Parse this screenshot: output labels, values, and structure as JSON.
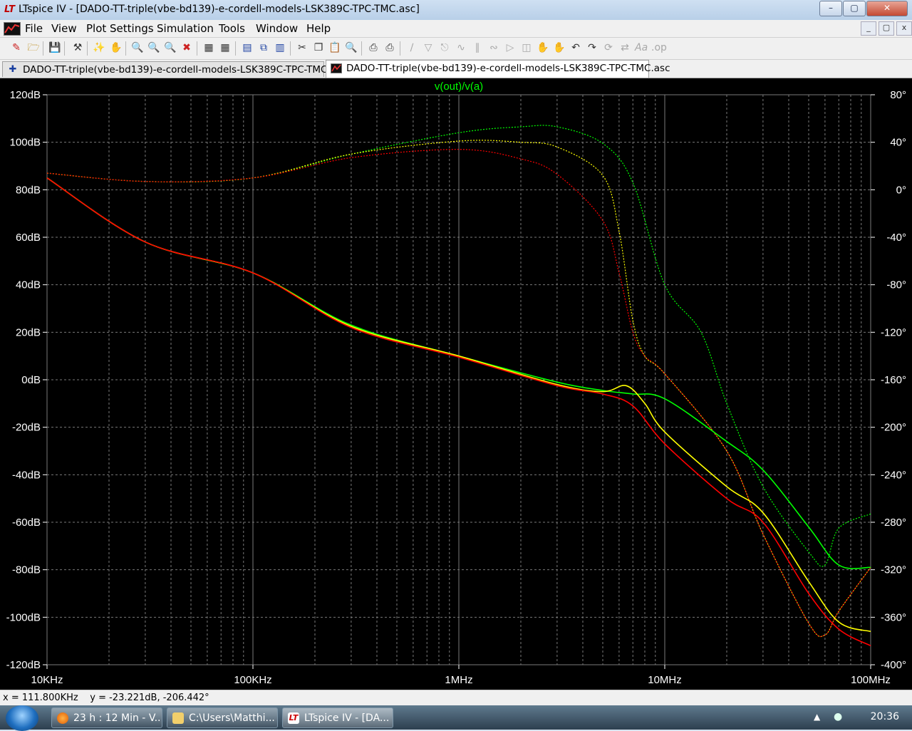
{
  "window": {
    "title": "LTspice IV - [DADO-TT-triple(vbe-bd139)-e-cordell-models-LSK389C-TPC-TMC.asc]",
    "app_icon": "ltspice-logo-icon",
    "controls": {
      "minimize": "–",
      "maximize": "▢",
      "close": "✕"
    }
  },
  "menu": {
    "items": [
      "File",
      "View",
      "Plot Settings",
      "Simulation",
      "Tools",
      "Window",
      "Help"
    ],
    "mdi_controls": [
      "_",
      "▢",
      "x"
    ]
  },
  "toolbar": {
    "icons": [
      "new-schematic-icon",
      "open-icon",
      "save-icon",
      "control-panel-icon",
      "run-icon",
      "pan-hand-icon",
      "zoom-in-icon",
      "zoom-area-icon",
      "zoom-out-icon",
      "zoom-cancel-icon",
      "autoscale-icon",
      "grid-icon",
      "tile-horizontal-icon",
      "cascade-icon",
      "tile-vertical-icon",
      "cut-icon",
      "copy-icon",
      "paste-icon",
      "find-icon",
      "print-setup-icon",
      "print-icon",
      "wire-icon",
      "ground-icon",
      "label-net-icon",
      "resistor-icon",
      "capacitor-icon",
      "inductor-icon",
      "diode-icon",
      "component-icon",
      "move-icon",
      "drag-icon",
      "undo-icon",
      "redo-icon",
      "rotate-icon",
      "mirror-icon",
      "text-icon",
      "spice-directive-icon"
    ]
  },
  "tabs": [
    {
      "label": "DADO-TT-triple(vbe-bd139)-e-cordell-models-LSK389C-TPC-TMC.asc",
      "icon": "schematic-icon",
      "active": false
    },
    {
      "label": "DADO-TT-triple(vbe-bd139)-e-cordell-models-LSK389C-TPC-TMC.asc",
      "icon": "waveform-icon",
      "active": true
    }
  ],
  "status": {
    "text": "x = 111.800KHz    y = -23.221dB, -206.442°"
  },
  "taskbar": {
    "items": [
      {
        "label": "23 h : 12 Min - V...",
        "icon": "firefox-icon"
      },
      {
        "label": "C:\\Users\\Matthi...",
        "icon": "folder-icon"
      },
      {
        "label": "LTspice IV - [DA...",
        "icon": "ltspice-icon",
        "active": true
      }
    ],
    "clock": "20:36",
    "start": "start-orb-icon"
  },
  "colors": {
    "plot_bg": "#000000",
    "grid": "#7a7a7a",
    "axis_text": "#ffffff",
    "trace_green": "#00ff00",
    "trace_yellow": "#ffff00",
    "trace_red": "#ff0000",
    "title_text": "#00ff00"
  },
  "chart_data": {
    "type": "line",
    "title": "v(out)/v(a)",
    "x_scale": "log",
    "xlim": [
      10000,
      100000000
    ],
    "x_tick_labels": [
      "10KHz",
      "100KHz",
      "1MHz",
      "10MHz",
      "100MHz"
    ],
    "ylim_left": [
      -120,
      120
    ],
    "y_left_tick_labels": [
      "120dB",
      "100dB",
      "80dB",
      "60dB",
      "40dB",
      "20dB",
      "0dB",
      "-20dB",
      "-40dB",
      "-60dB",
      "-80dB",
      "-100dB",
      "-120dB"
    ],
    "ylim_right": [
      -400,
      80
    ],
    "y_right_tick_labels": [
      "80°",
      "40°",
      "0°",
      "-40°",
      "-80°",
      "-120°",
      "-160°",
      "-200°",
      "-240°",
      "-280°",
      "-320°",
      "-360°",
      "-400°"
    ],
    "grid": true,
    "series": [
      {
        "color": "green",
        "quantity": "magnitude",
        "axis": "left",
        "x": [
          10000,
          30000,
          100000,
          300000,
          1000000,
          3000000,
          5000000,
          7000000,
          10000000,
          20000000,
          30000000,
          50000000,
          70000000,
          100000000
        ],
        "y": [
          85,
          58,
          45,
          23,
          10,
          -1,
          -4.5,
          -6,
          -8,
          -26,
          -38,
          -62,
          -78,
          -79
        ]
      },
      {
        "color": "yellow",
        "quantity": "magnitude",
        "axis": "left",
        "x": [
          10000,
          30000,
          100000,
          300000,
          1000000,
          3000000,
          5000000,
          6500000,
          8000000,
          10000000,
          20000000,
          30000000,
          50000000,
          70000000,
          100000000
        ],
        "y": [
          85,
          58,
          45,
          22.5,
          10,
          -2,
          -5,
          -2.5,
          -10,
          -22,
          -45,
          -56,
          -85,
          -102,
          -106
        ]
      },
      {
        "color": "red",
        "quantity": "magnitude",
        "axis": "left",
        "x": [
          10000,
          30000,
          100000,
          300000,
          1000000,
          3000000,
          5000000,
          7000000,
          10000000,
          20000000,
          30000000,
          50000000,
          70000000,
          100000000
        ],
        "y": [
          85,
          58,
          45,
          22,
          9.5,
          -2.5,
          -6,
          -11,
          -27,
          -50,
          -60,
          -90,
          -105,
          -112
        ]
      },
      {
        "color": "green",
        "quantity": "phase",
        "axis": "right",
        "x": [
          10000,
          30000,
          100000,
          300000,
          1000000,
          2000000,
          3000000,
          5000000,
          7000000,
          10000000,
          15000000,
          20000000,
          30000000,
          50000000,
          60000000,
          70000000,
          100000000
        ],
        "y": [
          14,
          7,
          10,
          30,
          48,
          53,
          53,
          39,
          6,
          -80,
          -120,
          -180,
          -250,
          -305,
          -316,
          -285,
          -273
        ]
      },
      {
        "color": "yellow",
        "quantity": "phase",
        "axis": "right",
        "x": [
          10000,
          30000,
          100000,
          300000,
          1000000,
          2000000,
          3000000,
          5000000,
          6000000,
          7000000,
          8000000,
          10000000,
          20000000,
          30000000,
          50000000,
          60000000,
          70000000,
          100000000
        ],
        "y": [
          14,
          7,
          10,
          30,
          41,
          40,
          36,
          12,
          -35,
          -110,
          -140,
          -155,
          -220,
          -290,
          -365,
          -375,
          -355,
          -318
        ]
      },
      {
        "color": "red",
        "quantity": "phase",
        "axis": "right",
        "x": [
          10000,
          30000,
          100000,
          300000,
          1000000,
          2000000,
          3000000,
          5000000,
          6000000,
          7000000,
          8000000,
          10000000,
          20000000,
          30000000,
          50000000,
          60000000,
          70000000,
          100000000
        ],
        "y": [
          14,
          7,
          10,
          27,
          34,
          26,
          13,
          -26,
          -70,
          -120,
          -140,
          -155,
          -220,
          -290,
          -365,
          -375,
          -355,
          -318
        ]
      }
    ]
  }
}
